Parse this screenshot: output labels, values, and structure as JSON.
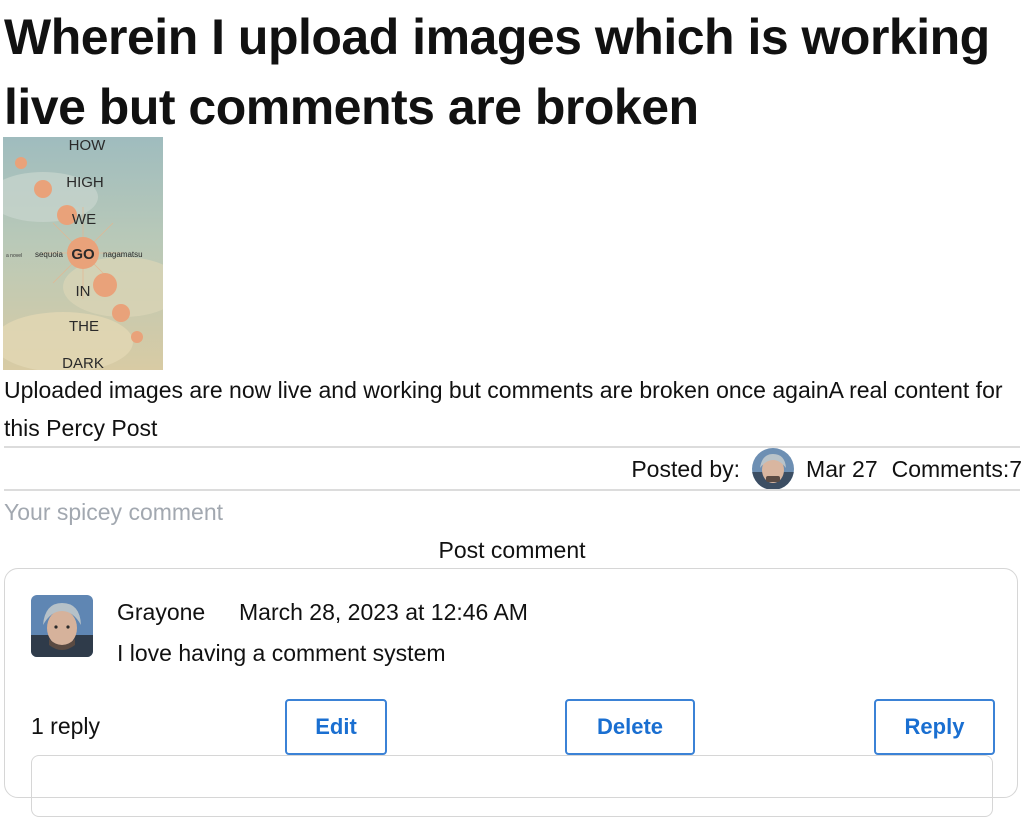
{
  "post": {
    "title": "Wherein I upload images which is working live but comments are broken",
    "cover_image": {
      "book_title_lines": [
        "HOW",
        "HIGH",
        "WE",
        "GO",
        "IN",
        "THE",
        "DARK"
      ],
      "author_left": "sequoia",
      "author_right": "nagamatsu",
      "tag": "a novel"
    },
    "body": "Uploaded images are now live and working but comments are broken once againA real content for this Percy Post",
    "meta": {
      "posted_by_label": "Posted by:",
      "date": "Mar 27",
      "comments_label": "Comments:7"
    }
  },
  "comment_form": {
    "placeholder": "Your spicey comment",
    "submit_label": "Post comment"
  },
  "comments": [
    {
      "author": "Grayone",
      "date": "March 28, 2023 at 12:46 AM",
      "text": "I love having a comment system",
      "replies_label": "1 reply",
      "edit_label": "Edit",
      "delete_label": "Delete",
      "reply_label": "Reply"
    }
  ],
  "colors": {
    "accent": "#1a6fd1",
    "placeholder": "#a2a8b0",
    "divider": "#dcdcdc"
  }
}
